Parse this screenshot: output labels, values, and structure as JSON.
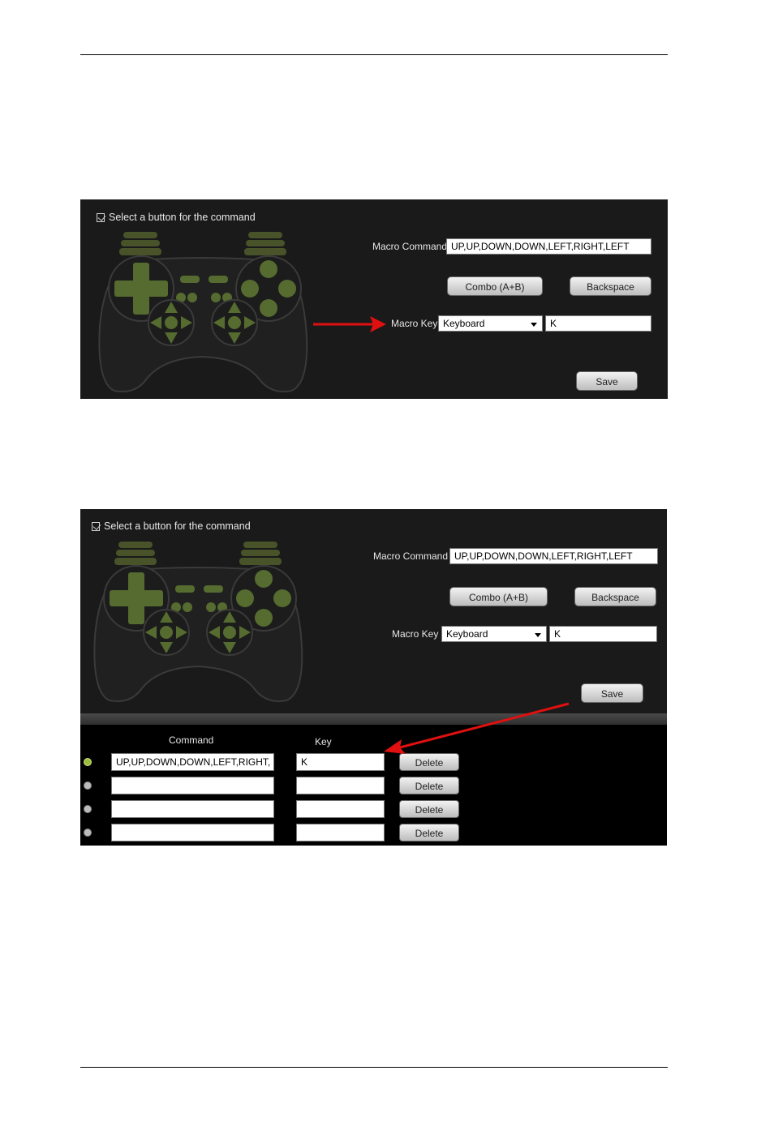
{
  "panel1": {
    "title": "Select a button for the command",
    "macro_command_label": "Macro Command",
    "macro_command_value": "UP,UP,DOWN,DOWN,LEFT,RIGHT,LEFT",
    "combo_label": "Combo (A+B)",
    "backspace_label": "Backspace",
    "macro_key_label": "Macro Key",
    "macro_key_type": "Keyboard",
    "macro_key_value": "K",
    "save_label": "Save"
  },
  "panel2": {
    "title": "Select a button for the command",
    "macro_command_label": "Macro Command",
    "macro_command_value": "UP,UP,DOWN,DOWN,LEFT,RIGHT,LEFT",
    "combo_label": "Combo (A+B)",
    "backspace_label": "Backspace",
    "macro_key_label": "Macro Key",
    "macro_key_type": "Keyboard",
    "macro_key_value": "K",
    "save_label": "Save",
    "table": {
      "col_command": "Command",
      "col_key": "Key",
      "delete_label": "Delete",
      "rows": [
        {
          "command": "UP,UP,DOWN,DOWN,LEFT,RIGHT,",
          "key": "K",
          "selected": true
        },
        {
          "command": "",
          "key": "",
          "selected": false
        },
        {
          "command": "",
          "key": "",
          "selected": false
        },
        {
          "command": "",
          "key": "",
          "selected": false
        }
      ]
    }
  },
  "colors": {
    "panel_bg": "#1a1a1a",
    "gamepad_accent": "#556b2f",
    "arrow": "#e01010"
  }
}
